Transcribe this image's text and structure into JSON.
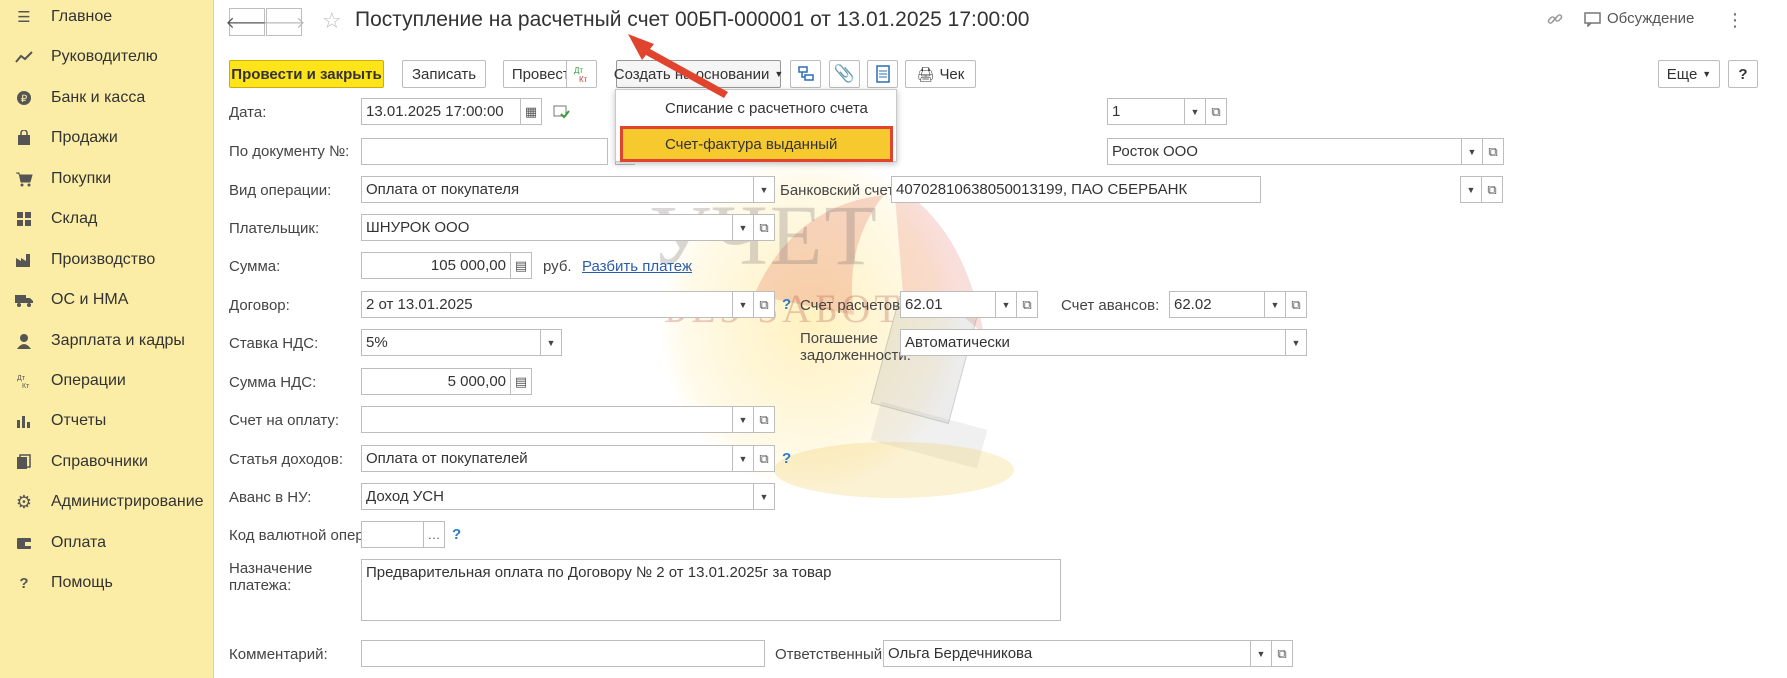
{
  "sidebar": {
    "items": [
      {
        "label": "Главное",
        "icon": "menu-icon"
      },
      {
        "label": "Руководителю",
        "icon": "trend-icon"
      },
      {
        "label": "Банк и касса",
        "icon": "coin-icon"
      },
      {
        "label": "Продажи",
        "icon": "bag-icon"
      },
      {
        "label": "Покупки",
        "icon": "cart-icon"
      },
      {
        "label": "Склад",
        "icon": "grid-icon"
      },
      {
        "label": "Производство",
        "icon": "factory-icon"
      },
      {
        "label": "ОС и НМА",
        "icon": "truck-icon"
      },
      {
        "label": "Зарплата и кадры",
        "icon": "person-icon"
      },
      {
        "label": "Операции",
        "icon": "dt-kt-icon"
      },
      {
        "label": "Отчеты",
        "icon": "bar-chart-icon"
      },
      {
        "label": "Справочники",
        "icon": "books-icon"
      },
      {
        "label": "Администрирование",
        "icon": "gear-icon"
      },
      {
        "label": "Оплата",
        "icon": "wallet-icon"
      },
      {
        "label": "Помощь",
        "icon": "help-icon"
      }
    ]
  },
  "header": {
    "title": "Поступление на расчетный счет 00БП-000001 от 13.01.2025 17:00:00",
    "discussion_label": "Обсуждение"
  },
  "toolbar": {
    "post_close": "Провести и закрыть",
    "save": "Записать",
    "post": "Провести",
    "dtkt": "Дт Кт",
    "create_based": "Создать на основании",
    "check": "Чек",
    "more": "Еще",
    "help": "?"
  },
  "menu": {
    "items": [
      "Списание с расчетного счета",
      "Счет-фактура выданный"
    ]
  },
  "form": {
    "date_label": "Дата:",
    "date_value": "13.01.2025 17:00:00",
    "number_partial": "1",
    "doc_label": "По документу №:",
    "doc_value": "",
    "org_value": "Росток ООО",
    "optype_label": "Вид операции:",
    "optype_value": "Оплата от покупателя",
    "bank_label": "Банковский счет:",
    "bank_value": "40702810638050013199, ПАО СБЕРБАНК",
    "payer_label": "Плательщик:",
    "payer_value": "ШНУРОК ООО",
    "sum_label": "Сумма:",
    "sum_value": "105 000,00",
    "currency": "руб.",
    "split_link": "Разбить платеж",
    "contract_label": "Договор:",
    "contract_value": "2 от 13.01.2025",
    "settle_label": "Счет расчетов:",
    "settle_value": "62.01",
    "advance_label": "Счет авансов:",
    "advance_value": "62.02",
    "vat_rate_label": "Ставка НДС:",
    "vat_rate_value": "5%",
    "debt_label_1": "Погашение",
    "debt_label_2": "задолженности:",
    "debt_value": "Автоматически",
    "vat_sum_label": "Сумма НДС:",
    "vat_sum_value": "5 000,00",
    "invoice_label": "Счет на оплату:",
    "invoice_value": "",
    "income_label": "Статья доходов:",
    "income_value": "Оплата от покупателей",
    "advance_nu_label": "Аванс в НУ:",
    "advance_nu_value": "Доход УСН",
    "currency_op_label": "Код валютной операции:",
    "currency_op_value": "",
    "purpose_label_1": "Назначение",
    "purpose_label_2": "платежа:",
    "purpose_value": "Предварительная оплата по Договору № 2 от 13.01.2025г за товар",
    "comment_label": "Комментарий:",
    "comment_value": "",
    "responsible_label": "Ответственный:",
    "responsible_value": "Ольга Бердечникова"
  },
  "watermark": {
    "line1": "УЧЕТ",
    "line2": "БЕЗ ЗАБОТ"
  },
  "colors": {
    "sidebar_bg": "#fbeda6",
    "primary_button": "#ffe41a",
    "menu_highlight": "#f6c92e",
    "highlight_border": "#e0442e",
    "arrow": "#e0442e",
    "link": "#2c5ea8"
  }
}
